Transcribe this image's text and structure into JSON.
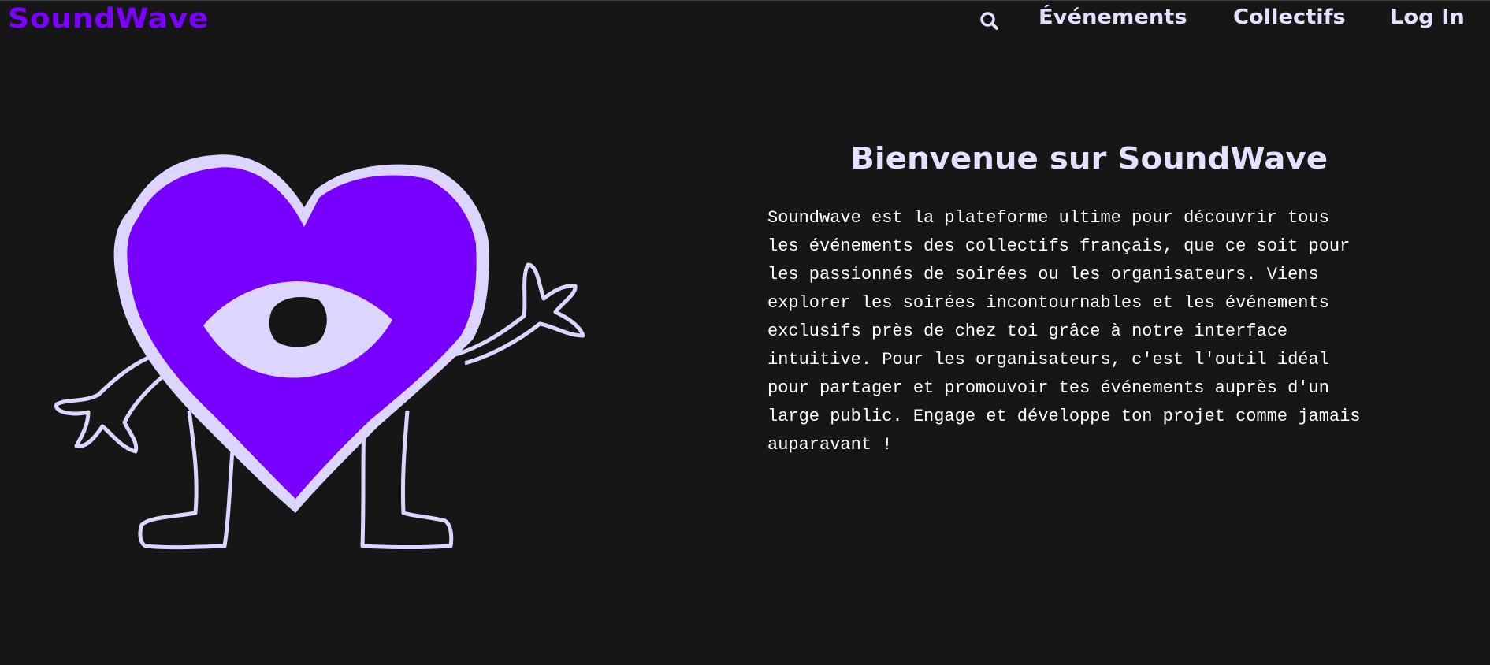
{
  "header": {
    "brand": "SoundWave",
    "nav": {
      "search_icon": "search-icon",
      "events_label": "Événements",
      "collectifs_label": "Collectifs",
      "login_label": "Log In"
    }
  },
  "hero": {
    "illustration": "heart-mascot-illustration",
    "title": "Bienvenue sur SoundWave",
    "description": "Soundwave est la plateforme ultime pour découvrir tous les événements des collectifs français, que ce soit pour les passionnés de soirées ou les organisateurs. Viens explorer les soirées incontournables et les événements exclusifs près de chez toi grâce à notre interface intuitive. Pour les organisateurs, c'est l'outil idéal pour partager et promouvoir tes événements auprès d'un large public. Engage et développe ton projet comme jamais auparavant !"
  },
  "colors": {
    "background": "#161616",
    "brand_purple": "#7b00ff",
    "lavender": "#e4e0ff",
    "text": "#ffffff"
  }
}
